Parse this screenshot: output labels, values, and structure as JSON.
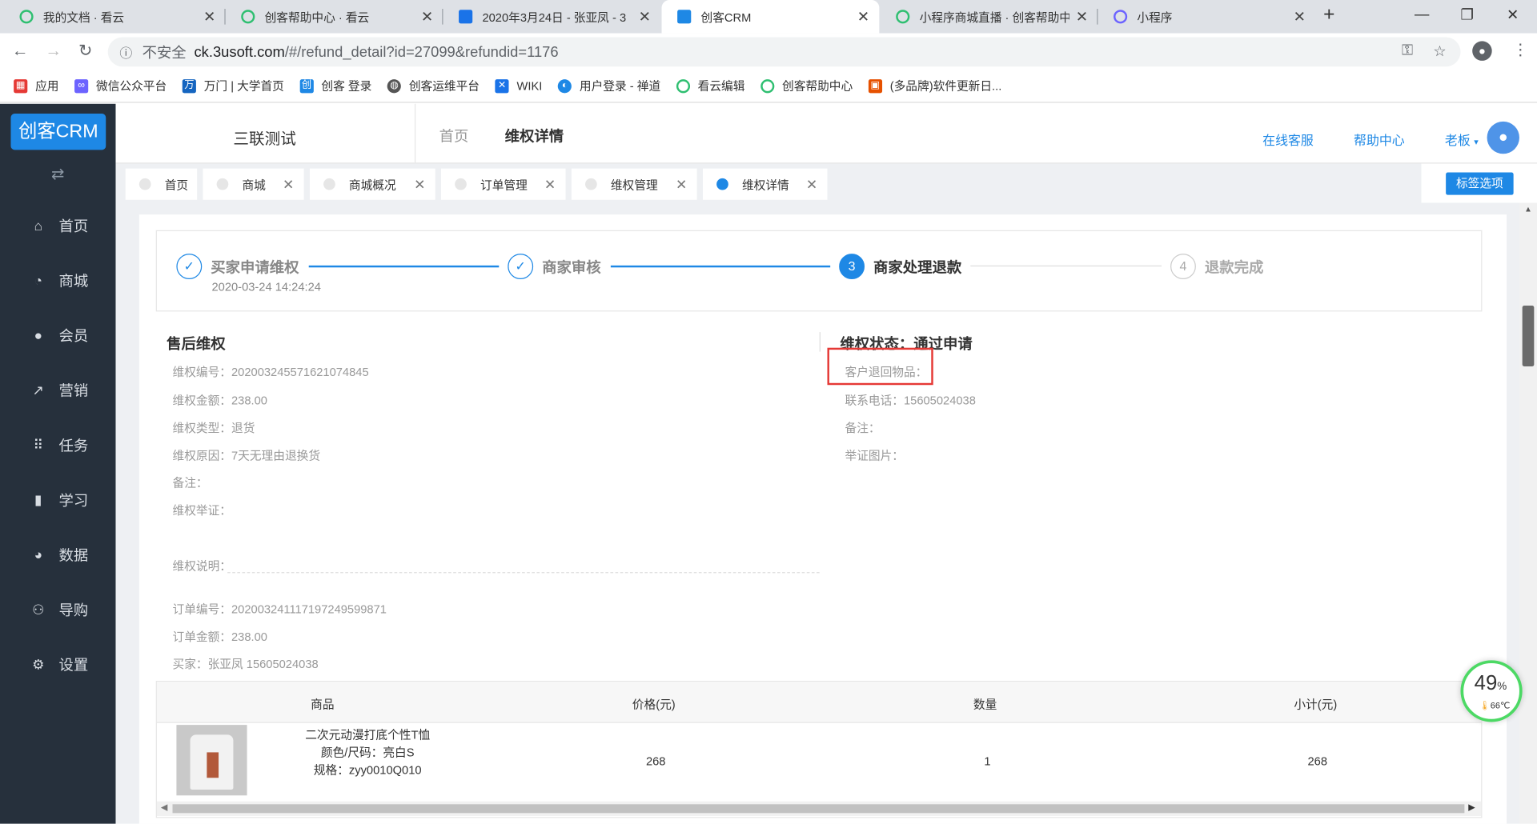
{
  "browser": {
    "tabs": [
      {
        "title": "我的文档 · 看云",
        "icon_color": "#2fbf71"
      },
      {
        "title": "创客帮助中心 · 看云",
        "icon_color": "#2fbf71"
      },
      {
        "title": "2020年3月24日 - 张亚凤 - 3",
        "icon_color": "#1a73e8"
      },
      {
        "title": "创客CRM",
        "icon_color": "#1e88e5"
      },
      {
        "title": "小程序商城直播 · 创客帮助中",
        "icon_color": "#2fbf71"
      },
      {
        "title": "小程序",
        "icon_color": "#6c63ff"
      }
    ],
    "new_tab": "+",
    "insecure_label": "不安全",
    "url_domain": "ck.3usoft.com",
    "url_path": "/#/refund_detail?id=27099&refundid=1176",
    "bookmarks": [
      {
        "label": "应用",
        "icon": "apps-icon",
        "color": "#e53935"
      },
      {
        "label": "微信公众平台",
        "icon": "link-icon",
        "color": "#6c63ff"
      },
      {
        "label": "万门 | 大学首页",
        "icon": "wanmen-icon",
        "color": "#1565c0"
      },
      {
        "label": "创客 登录",
        "icon": "chuangke-icon",
        "color": "#1e88e5"
      },
      {
        "label": "创客运维平台",
        "icon": "globe-icon",
        "color": "#555555"
      },
      {
        "label": "WIKI",
        "icon": "confluence-icon",
        "color": "#1a73e8"
      },
      {
        "label": "用户登录 - 禅道",
        "icon": "zentao-icon",
        "color": "#1e88e5"
      },
      {
        "label": "看云编辑",
        "icon": "kancloud-icon",
        "color": "#2fbf71"
      },
      {
        "label": "创客帮助中心",
        "icon": "kancloud-icon",
        "color": "#2fbf71"
      },
      {
        "label": "(多品牌)软件更新日...",
        "icon": "doc-icon",
        "color": "#e65100"
      }
    ]
  },
  "app": {
    "logo": "创客CRM",
    "menu": [
      {
        "label": "首页",
        "icon": "home-icon"
      },
      {
        "label": "商城",
        "icon": "store-icon"
      },
      {
        "label": "会员",
        "icon": "user-icon"
      },
      {
        "label": "营销",
        "icon": "trend-icon"
      },
      {
        "label": "任务",
        "icon": "grid-icon"
      },
      {
        "label": "学习",
        "icon": "book-icon"
      },
      {
        "label": "数据",
        "icon": "pie-icon"
      },
      {
        "label": "导购",
        "icon": "group-icon"
      },
      {
        "label": "设置",
        "icon": "gear-icon"
      }
    ],
    "shop_name": "三联测试",
    "breadcrumb_home": "首页",
    "breadcrumb_current": "维权详情",
    "top_links": {
      "service": "在线客服",
      "help": "帮助中心",
      "user": "老板"
    },
    "tags": [
      {
        "label": "首页",
        "closable": false,
        "active": false
      },
      {
        "label": "商城",
        "closable": true,
        "active": false
      },
      {
        "label": "商城概况",
        "closable": true,
        "active": false
      },
      {
        "label": "订单管理",
        "closable": true,
        "active": false
      },
      {
        "label": "维权管理",
        "closable": true,
        "active": false
      },
      {
        "label": "维权详情",
        "closable": true,
        "active": true
      }
    ],
    "tag_options_button": "标签选项"
  },
  "refund": {
    "steps": [
      {
        "label": "买家申请维权",
        "state": "done",
        "date": "2020-03-24 14:24:24"
      },
      {
        "label": "商家审核",
        "state": "done"
      },
      {
        "label": "商家处理退款",
        "state": "current",
        "num": "3"
      },
      {
        "label": "退款完成",
        "state": "todo",
        "num": "4"
      }
    ],
    "after_sale_title": "售后维权",
    "fields": {
      "no": {
        "label": "维权编号：",
        "value": "20200324557162107484​5"
      },
      "amount": {
        "label": "维权金额：",
        "value": "238.00"
      },
      "type": {
        "label": "维权类型：",
        "value": "退货"
      },
      "reason": {
        "label": "维权原因：",
        "value": "7天无理由退换货"
      },
      "remark": {
        "label": "备注：",
        "value": ""
      },
      "evidence": {
        "label": "维权举证：",
        "value": ""
      },
      "desc": {
        "label": "维权说明：",
        "value": ""
      },
      "order_no": {
        "label": "订单编号：",
        "value": "2020032411171972495998​71"
      },
      "order_amount": {
        "label": "订单金额：",
        "value": "238.00"
      },
      "buyer": {
        "label": "买家：",
        "value": "张亚凤  15605024038"
      }
    },
    "status_title": "维权状态：通过申请",
    "status_fields": {
      "return_goods": "客户退回物品：",
      "phone": "联系电话：15605024038",
      "remark": "备注：",
      "images": "举证图片："
    },
    "table": {
      "headers": [
        "商品",
        "价格(元)",
        "数量",
        "小计(元)"
      ],
      "rows": [
        {
          "name": "二次元动漫打底个性T恤",
          "color": "颜色/尺码：亮白S",
          "spec": "规格：zyy0010Q010",
          "price": "268",
          "qty": "1",
          "subtotal": "268"
        }
      ]
    }
  },
  "widget": {
    "percent": "49",
    "percent_sign": "%",
    "temp": "66℃"
  }
}
